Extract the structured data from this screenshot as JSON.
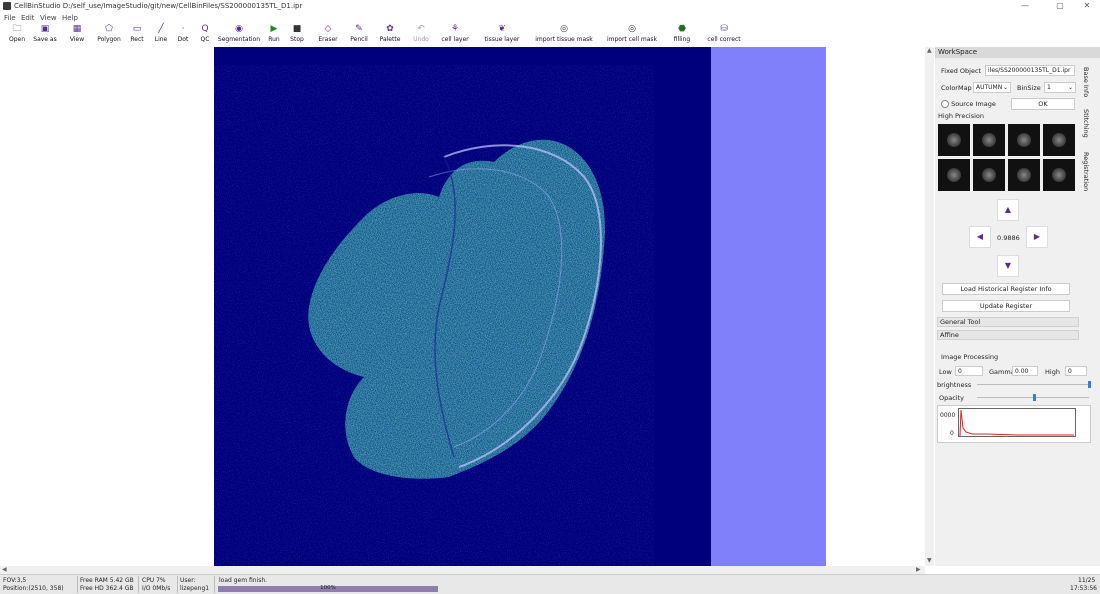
{
  "window": {
    "title": "CellBinStudio D:/self_use/ImageStudio/git/new/CellBinFiles/SS200000135TL_D1.ipr",
    "minimize": "—",
    "maximize": "▢",
    "close": "✕"
  },
  "menu": [
    "File",
    "Edit",
    "View",
    "Help"
  ],
  "toolbar": [
    {
      "id": "open",
      "label": "Open",
      "icon": "folder-icon",
      "glyph": "🗀"
    },
    {
      "id": "saveas",
      "label": "Save as",
      "icon": "save-icon",
      "glyph": "▣"
    },
    {
      "id": "view",
      "label": "View",
      "icon": "image-icon",
      "glyph": "▦"
    },
    {
      "id": "polygon",
      "label": "Polygon",
      "icon": "polygon-icon",
      "glyph": "⬠"
    },
    {
      "id": "rect",
      "label": "Rect",
      "icon": "rect-icon",
      "glyph": "▭"
    },
    {
      "id": "line",
      "label": "Line",
      "icon": "line-icon",
      "glyph": "╱"
    },
    {
      "id": "dot",
      "label": "Dot",
      "icon": "dot-icon",
      "glyph": "·"
    },
    {
      "id": "qc",
      "label": "QC",
      "icon": "qc-icon",
      "glyph": "Q"
    },
    {
      "id": "segmentation",
      "label": "Segmentation",
      "icon": "eye-icon",
      "glyph": "◉"
    },
    {
      "id": "run",
      "label": "Run",
      "icon": "play-icon",
      "glyph": "▶"
    },
    {
      "id": "stop",
      "label": "Stop",
      "icon": "stop-icon",
      "glyph": "■"
    },
    {
      "id": "eraser",
      "label": "Eraser",
      "icon": "eraser-icon",
      "glyph": "◇"
    },
    {
      "id": "pencil",
      "label": "Pencil",
      "icon": "pencil-icon",
      "glyph": "✎"
    },
    {
      "id": "palette",
      "label": "Palette",
      "icon": "palette-icon",
      "glyph": "✿"
    },
    {
      "id": "undo",
      "label": "Undo",
      "icon": "undo-icon",
      "glyph": "↶"
    },
    {
      "id": "celllayer",
      "label": "cell layer",
      "icon": "cell-layer-icon",
      "glyph": "⚘"
    },
    {
      "id": "tissuelayer",
      "label": "tissue layer",
      "icon": "tissue-layer-icon",
      "glyph": "❦"
    },
    {
      "id": "importtissue",
      "label": "import tissue mask",
      "icon": "import-tissue-icon",
      "glyph": "◎"
    },
    {
      "id": "importcell",
      "label": "import cell mask",
      "icon": "import-cell-icon",
      "glyph": "◎"
    },
    {
      "id": "filling",
      "label": "filling",
      "icon": "filling-icon",
      "glyph": "⬣"
    },
    {
      "id": "cellcorrect",
      "label": "cell correct",
      "icon": "cell-correct-icon",
      "glyph": "⛁"
    }
  ],
  "workspace": {
    "header": "WorkSpace",
    "fixed_object_label": "Fixed Object",
    "fixed_object_value": "iles/SS200000135TL_D1.ipr",
    "colormap_label": "ColorMap",
    "colormap_value": "AUTUMN",
    "binsize_label": "BinSize",
    "binsize_value": "1",
    "source_image_label": "Source Image",
    "ok_label": "OK",
    "high_precision_label": "High Precision",
    "scale_value": "0.9886",
    "load_history_label": "Load Historical Register Info",
    "update_register_label": "Update Register",
    "general_tool_label": "General Tool",
    "affine_label": "Affine",
    "image_processing_label": "Image Processing",
    "low_label": "Low",
    "low_value": "0",
    "gamma_label": "Gamma",
    "gamma_value": "0.00",
    "high_label": "High",
    "high_value": "0",
    "brightness_label": "brightness",
    "opacity_label": "Opacity",
    "hist_y_top": "0000",
    "hist_y_bottom": "0",
    "tabs": [
      "Base Info",
      "Stitching",
      "Registration"
    ]
  },
  "status": {
    "fov": "FOV:3,5",
    "position": "Position:(2510, 358)",
    "free_ram": "Free RAM 5.42 GB",
    "free_hd": "Free HD 362.4 GB",
    "cpu": "CPU 7%",
    "io": "I/O 0Mb/s",
    "user_label": "User:",
    "user": "lizepeng1",
    "message": "load gem finish.",
    "progress": "100%",
    "progress_value": 1.0,
    "date": "11/25",
    "time": "17:53:56"
  },
  "colors": {
    "image_bg": "#00007d",
    "image_side": "#8080fb",
    "tissue_green": "#2fb0a0",
    "tissue_outline": "#c8c8ff",
    "accent": "#5b2d8c"
  }
}
